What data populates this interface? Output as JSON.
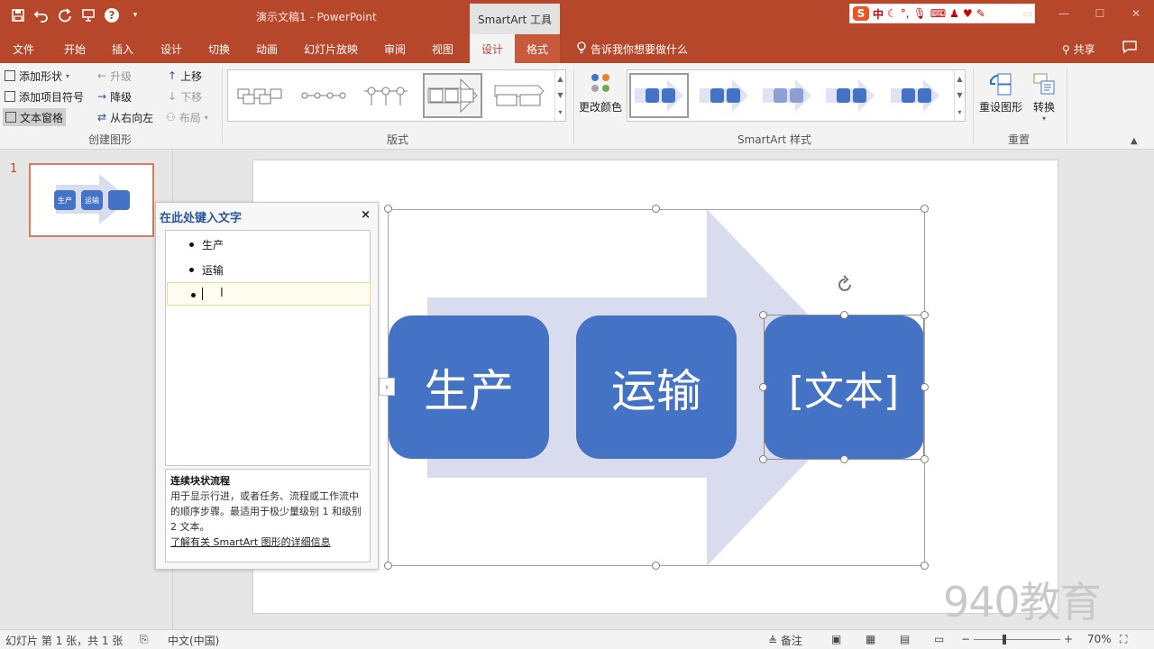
{
  "titlebar": {
    "doc_title": "演示文稿1  -  PowerPoint",
    "context_tab": "SmartArt 工具",
    "ime_label": "中"
  },
  "tabs": {
    "items": [
      "文件",
      "开始",
      "插入",
      "设计",
      "切换",
      "动画",
      "幻灯片放映",
      "审阅",
      "视图",
      "设计",
      "格式"
    ],
    "tell_me": "告诉我你想要做什么",
    "share": "共享"
  },
  "ribbon": {
    "create": {
      "add_shape": "添加形状",
      "add_bullet": "添加项目符号",
      "text_pane": "文本窗格",
      "promote": "升级",
      "demote": "降级",
      "right_to_left": "从右向左",
      "move_up": "上移",
      "move_down": "下移",
      "layout": "布局",
      "group_label": "创建图形"
    },
    "layouts_label": "版式",
    "change_colors": "更改颜色",
    "styles_label": "SmartArt 样式",
    "reset_graphic": "重设图形",
    "convert": "转换",
    "reset_label": "重置"
  },
  "thumb": {
    "slide_number": "1",
    "box1": "生产",
    "box2": "运输"
  },
  "text_pane": {
    "title": "在此处键入文字",
    "close": "×",
    "items": [
      "生产",
      "运输",
      ""
    ],
    "desc_title": "连续块状流程",
    "desc_body": "用于显示行进，或者任务、流程或工作流中的顺序步骤。最适用于极少量级别 1 和级别 2 文本。",
    "desc_link": "了解有关 SmartArt 图形的详细信息"
  },
  "smartart": {
    "boxes": [
      "生产",
      "运输",
      "[文本]"
    ],
    "color": "#4472c4",
    "arrow_color": "#d9dcee"
  },
  "watermark": "940教育",
  "status": {
    "slide_info": "幻灯片 第 1 张，共 1 张",
    "language": "中文(中国)",
    "notes": "备注",
    "zoom": "70%"
  }
}
